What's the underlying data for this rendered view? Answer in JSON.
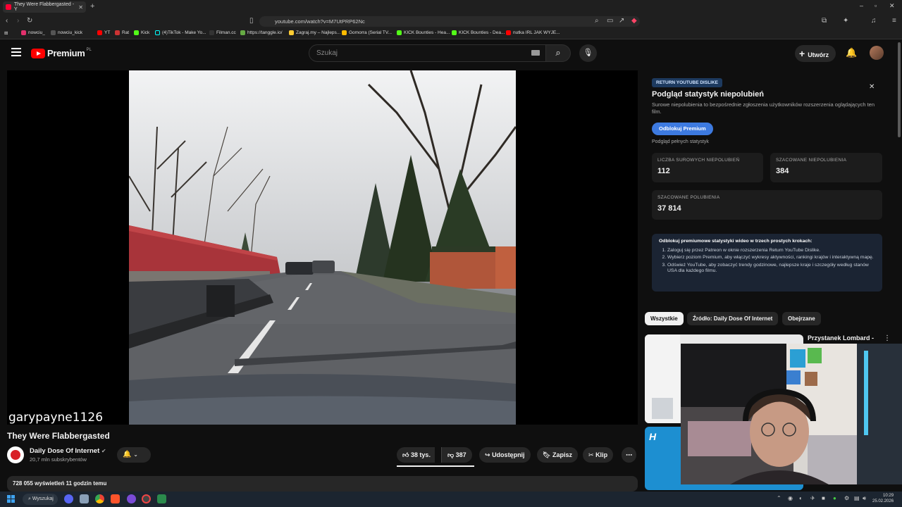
{
  "browser": {
    "tab_title": "They Were Flabbergasted - Y",
    "url": "youtube.com/watch?v=M7UtPRP62Nc",
    "bookmarks": [
      "nowciu_",
      "nowciu_kick",
      "YT",
      "Rat",
      "Kick",
      "(4)TikTok - Make Yo...",
      "Filman.cc",
      "https://tanggle.io/",
      "Zagraj.my – Najleps...",
      "Gomorra (Serial TV...",
      "KICK Bounties - Hea...",
      "KICK Bounties - Dea...",
      "nutka IRL JAK WYJE..."
    ]
  },
  "header": {
    "logo_text": "Premium",
    "region": "PL",
    "search_placeholder": "Szukaj",
    "create_label": "Utwórz"
  },
  "video": {
    "watermark": "garypayne1126",
    "title": "They Were Flabbergasted",
    "channel": "Daily Dose Of Internet",
    "subscribers": "20,7 mln subskrybentów",
    "likes": "38 tys.",
    "dislikes": "387",
    "share": "Udostępnij",
    "save": "Zapisz",
    "clip": "Klip",
    "views_time": "728 055 wyświetleń  11 godzin temu"
  },
  "ryd": {
    "badge": "RETURN YOUTUBE DISLIKE",
    "title": "Podgląd statystyk niepolubień",
    "description": "Surowe niepolubienia to bezpośrednie zgłoszenia użytkowników rozszerzenia oglądających ten film.",
    "unlock_button": "Odblokuj Premium",
    "full_stats_link": "Podgląd pełnych statystyk",
    "stats": [
      {
        "label": "LICZBA SUROWYCH NIEPOLUBIEŃ",
        "value": "112"
      },
      {
        "label": "SZACOWANE NIEPOLUBIENIA",
        "value": "384"
      },
      {
        "label": "SZACOWANE POLUBIENIA",
        "value": "37 814"
      }
    ],
    "steps_heading": "Odblokuj premiumowe statystyki wideo w trzech prostych krokach:",
    "steps": [
      "Zaloguj się przez Patreon w oknie rozszerzenia Return YouTube Dislike.",
      "Wybierz poziom Premium, aby włączyć wykresy aktywności, rankingi krajów i interaktywną mapę.",
      "Odśwież YouTube, aby zobaczyć trendy godzinowe, najlepsze kraje i szczegóły według stanów USA dla każdego filmu."
    ]
  },
  "chips": [
    "Wszystkie",
    "Źródło: Daily Dose Of Internet",
    "Obejrzane"
  ],
  "recommendations": [
    {
      "title": "Przystanek Lombard -"
    }
  ],
  "taskbar": {
    "search_label": "Wyszukaj",
    "time": "10:29",
    "date": "25.02.2026"
  }
}
